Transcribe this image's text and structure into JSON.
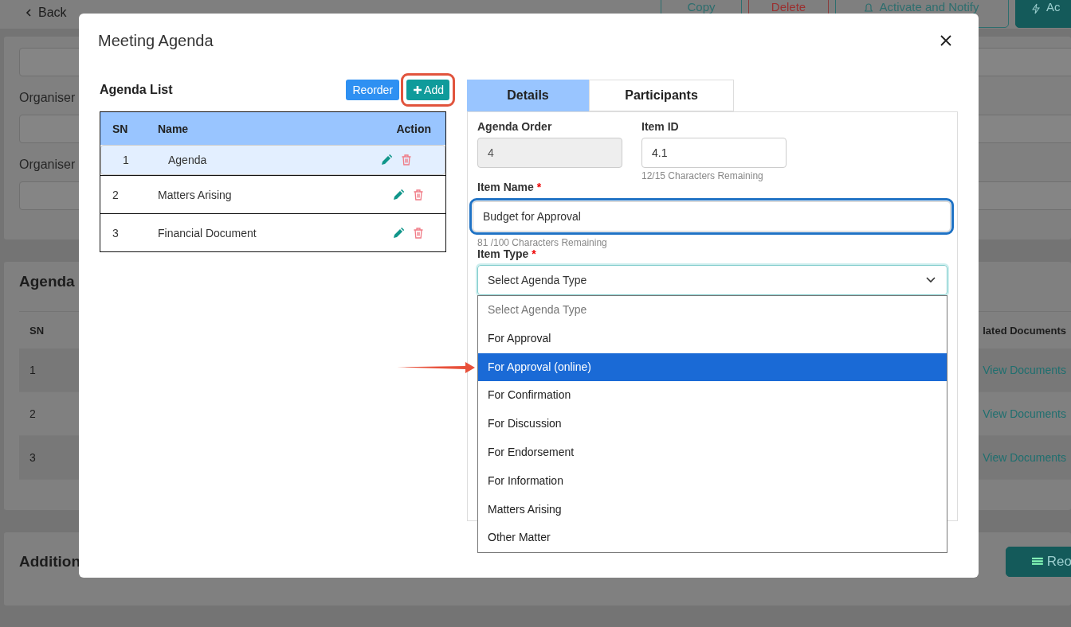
{
  "page": {
    "back": "Back",
    "actions": [
      {
        "label": "Copy",
        "kind": "outline"
      },
      {
        "label": "Delete",
        "kind": "danger"
      },
      {
        "label": "Activate and Notify",
        "kind": "bell"
      },
      {
        "label": "Ac",
        "kind": "primary"
      }
    ],
    "details_fields": [
      {
        "label": "Organiser"
      },
      {
        "label": "Organiser"
      }
    ],
    "agenda_section": {
      "title": "Agenda",
      "columns": [
        "SN",
        "lated Documents"
      ],
      "rows": [
        {
          "sn": "1",
          "link": "View Documents"
        },
        {
          "sn": "2",
          "link": "View Documents"
        },
        {
          "sn": "3",
          "link": "View Documents"
        }
      ]
    },
    "additional_section": {
      "title": "Addition",
      "button": "Reo"
    }
  },
  "modal": {
    "title": "Meeting Agenda",
    "agenda_list": {
      "title": "Agenda List",
      "buttons": [
        {
          "label": "Reorder",
          "kind": "reorder",
          "highlighted": false
        },
        {
          "label": "Add",
          "kind": "add",
          "highlighted": true
        }
      ],
      "columns": [
        "SN",
        "Name",
        "Action"
      ],
      "rows": [
        {
          "sn": "1",
          "name": "Agenda",
          "selected": true
        },
        {
          "sn": "2",
          "name": "Matters Arising",
          "selected": false
        },
        {
          "sn": "3",
          "name": "Financial Document",
          "selected": false
        }
      ]
    },
    "tabs": [
      {
        "label": "Details",
        "selected": true
      },
      {
        "label": "Participants",
        "selected": false
      }
    ],
    "form": {
      "agenda_order": {
        "label": "Agenda Order",
        "value": "4",
        "disabled": true
      },
      "item_id": {
        "label": "Item ID",
        "value": "4.1",
        "disabled": false,
        "hint": "12/15 Characters Remaining"
      },
      "item_name": {
        "label": "Item Name",
        "required_mark": "*",
        "value": "Budget for Approval",
        "highlighted": true,
        "hint": "81 /100 Characters Remaining"
      },
      "item_type": {
        "label": "Item Type",
        "required_mark": "*",
        "value": "Select Agenda Type",
        "expanded": true,
        "options": [
          {
            "label": "Select Agenda Type",
            "disabled": true,
            "highlighted": false,
            "pointed": false
          },
          {
            "label": "For Approval",
            "disabled": false,
            "highlighted": false,
            "pointed": false
          },
          {
            "label": "For Approval (online)",
            "disabled": false,
            "highlighted": true,
            "pointed": true
          },
          {
            "label": "For Confirmation",
            "disabled": false,
            "highlighted": false,
            "pointed": false
          },
          {
            "label": "For Discussion",
            "disabled": false,
            "highlighted": false,
            "pointed": false
          },
          {
            "label": "For Endorsement",
            "disabled": false,
            "highlighted": false,
            "pointed": false
          },
          {
            "label": "For Information",
            "disabled": false,
            "highlighted": false,
            "pointed": false
          },
          {
            "label": "Matters Arising",
            "disabled": false,
            "highlighted": false,
            "pointed": false
          },
          {
            "label": "Other Matter",
            "disabled": false,
            "highlighted": false,
            "pointed": false
          }
        ]
      }
    }
  }
}
